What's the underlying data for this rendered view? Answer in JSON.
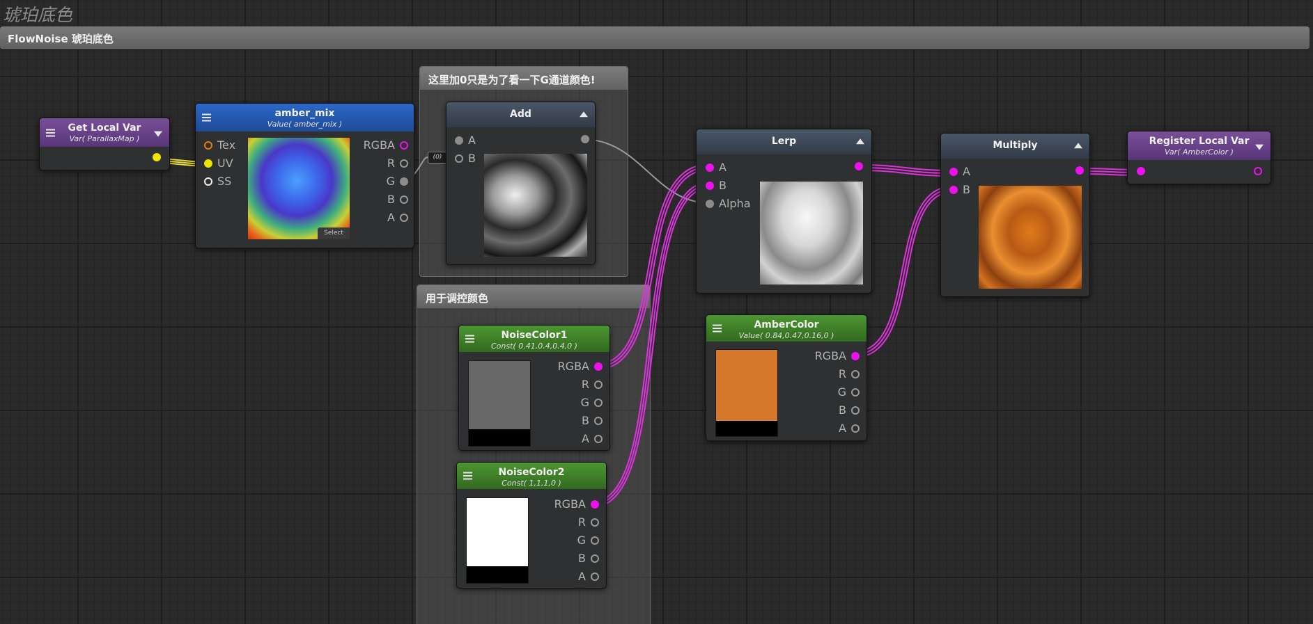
{
  "graph_title": "琥珀底色",
  "group": {
    "title": "FlowNoise 琥珀底色"
  },
  "comments": {
    "note_g": "这里加0只是为了看一下G通道颜色!",
    "note_color": "用于调控颜色"
  },
  "reroute": {
    "label": "(0)"
  },
  "nodes": {
    "get_local_var": {
      "title": "Get Local Var",
      "subtitle": "Var( ParallaxMap )"
    },
    "amber_mix": {
      "title": "amber_mix",
      "subtitle": "Value( amber_mix )",
      "inputs": [
        "Tex",
        "UV",
        "SS"
      ],
      "outputs": [
        "RGBA",
        "R",
        "G",
        "B",
        "A"
      ],
      "select_label": "Select"
    },
    "add": {
      "title": "Add",
      "inputs": [
        "A",
        "B"
      ]
    },
    "lerp": {
      "title": "Lerp",
      "inputs": [
        "A",
        "B",
        "Alpha"
      ]
    },
    "multiply": {
      "title": "Multiply",
      "inputs": [
        "A",
        "B"
      ]
    },
    "register_local_var": {
      "title": "Register Local Var",
      "subtitle": "Var( AmberColor )"
    },
    "noise_color1": {
      "title": "NoiseColor1",
      "subtitle": "Const( 0.41,0.4,0.4,0 )",
      "outputs": [
        "RGBA",
        "R",
        "G",
        "B",
        "A"
      ],
      "swatch_color": "#686767"
    },
    "noise_color2": {
      "title": "NoiseColor2",
      "subtitle": "Const( 1,1,1,0 )",
      "outputs": [
        "RGBA",
        "R",
        "G",
        "B",
        "A"
      ],
      "swatch_color": "#ffffff"
    },
    "amber_color": {
      "title": "AmberColor",
      "subtitle": "Value( 0.84,0.47,0.16,0 )",
      "outputs": [
        "RGBA",
        "R",
        "G",
        "B",
        "A"
      ],
      "swatch_color": "#d6782a"
    }
  },
  "colors": {
    "wire_color": "#dd33dd",
    "wire_uv": "#e6dc2e",
    "wire_gray": "#9a9a9a"
  }
}
